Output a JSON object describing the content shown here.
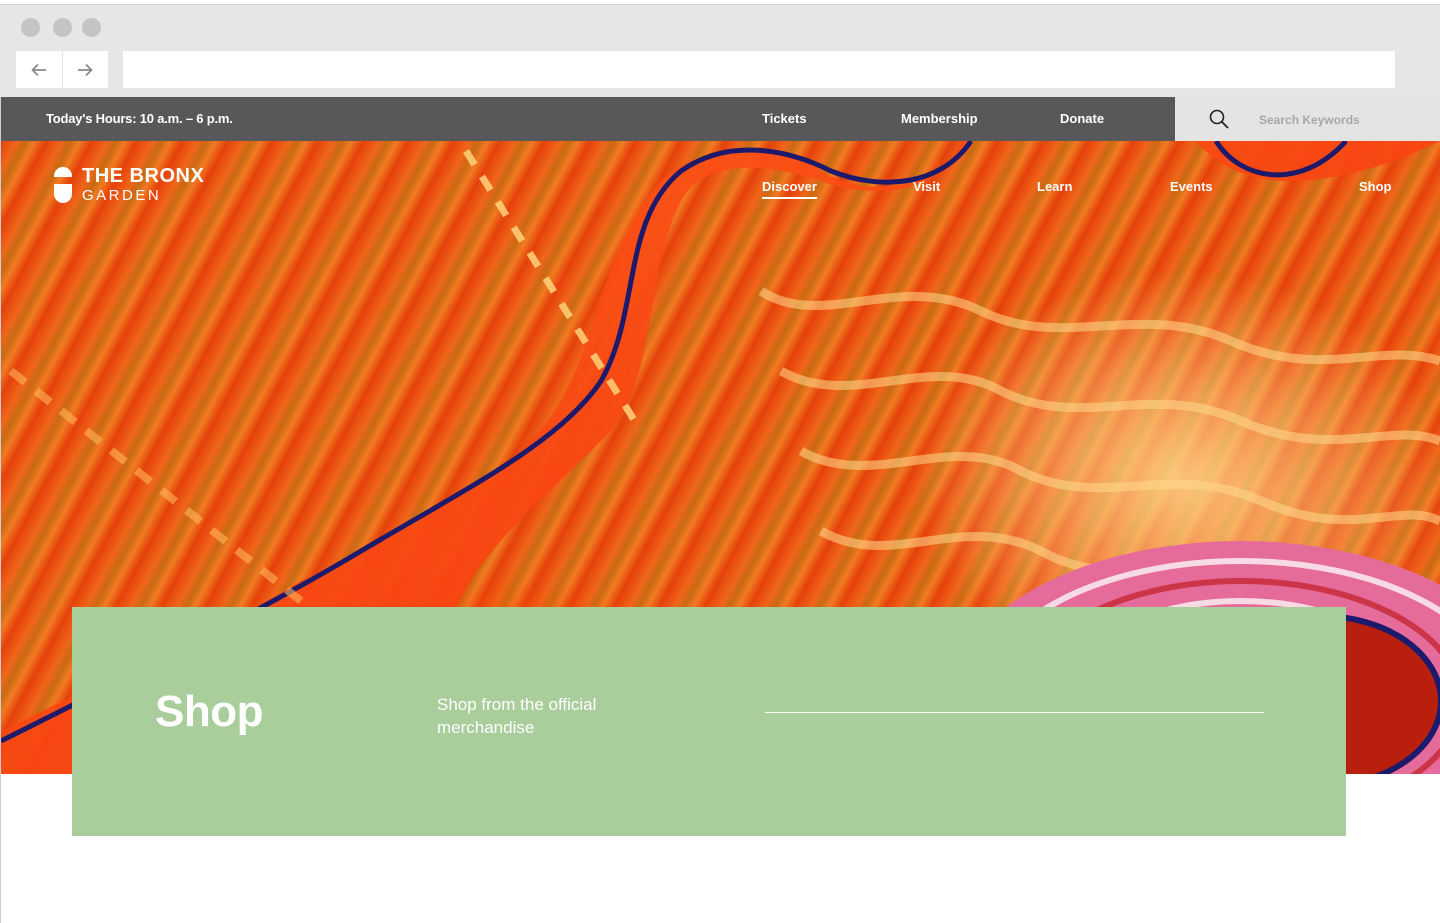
{
  "browser": {
    "back_icon": "arrow-left-icon",
    "forward_icon": "arrow-right-icon",
    "url": ""
  },
  "utility_bar": {
    "hours": "Today's Hours: 10 a.m. – 6 p.m.",
    "links": [
      "Tickets",
      "Membership",
      "Donate"
    ],
    "search_placeholder": "Search Keywords",
    "background": "#58585a"
  },
  "logo": {
    "line1": "THE BRONX",
    "line2": "GARDEN"
  },
  "main_nav": {
    "items": [
      "Discover",
      "Visit",
      "Learn",
      "Events",
      "Shop"
    ],
    "active": "Discover"
  },
  "panel": {
    "title": "Shop",
    "description": "Shop from the official merchandise",
    "background": "#aacd9c"
  }
}
